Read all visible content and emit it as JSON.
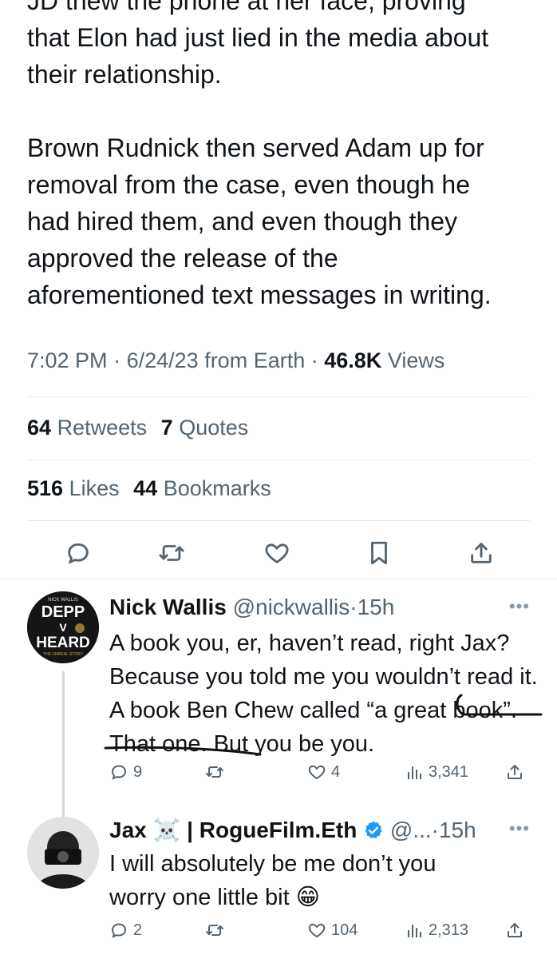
{
  "tweet": {
    "body": "JD thew the phone at her face, proving\nthat Elon had just lied in the media about\ntheir relationship.\n\nBrown Rudnick then served Adam up for\nremoval from the case, even though he\nhad hired them, and even though they\napproved the release of the\naforementioned text messages in writing.",
    "time": "7:02 PM",
    "date": "6/24/23",
    "source": "from Earth",
    "views_count": "46.8K",
    "views_label": "Views",
    "retweets_count": "64",
    "retweets_label": "Retweets",
    "quotes_count": "7",
    "quotes_label": "Quotes",
    "likes_count": "516",
    "likes_label": "Likes",
    "bookmarks_count": "44",
    "bookmarks_label": "Bookmarks"
  },
  "actions": [
    "reply-icon",
    "retweet-icon",
    "like-icon",
    "bookmark-icon",
    "share-icon"
  ],
  "replies": [
    {
      "name": "Nick Wallis",
      "handle": "@nickwallis",
      "time": "15h",
      "text": "A book you, er, haven’t read, right Jax? Because you told me you wouldn’t read it. A book Ben Chew called “a great book”. That one. But you be you.",
      "avatar": {
        "top": "NICK WALLIS",
        "line1": "DEPP",
        "line2": "V",
        "line3": "HEARD",
        "bottom": "THE UNREAL STORY"
      },
      "reply_count": "9",
      "like_count": "4",
      "view_count": "3,341"
    },
    {
      "name": "Jax",
      "name_emoji": "☠️",
      "name_rest": "| RogueFilm.Eth",
      "handle": "@...",
      "time": "15h",
      "text": "I will absolutely be me don’t you worry one little bit 😁",
      "reply_count": "2",
      "like_count": "104",
      "view_count": "2,313"
    }
  ],
  "colors": {
    "text": "#0f1419",
    "secondary": "#536471",
    "divider": "#e6e9ec",
    "verified": "#1d9bf0"
  }
}
